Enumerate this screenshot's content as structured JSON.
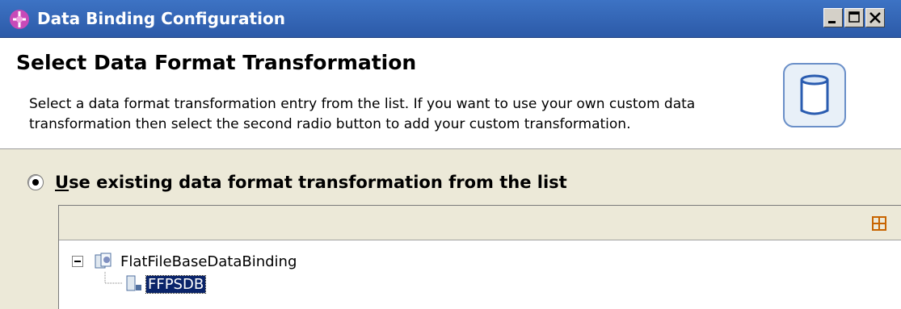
{
  "window": {
    "title": "Data Binding Configuration",
    "title_icon": "plug-in-icon",
    "controls": [
      "minimize",
      "maximize",
      "close"
    ]
  },
  "header": {
    "title": "Select Data Format Transformation",
    "description": "Select a data format transformation entry from the list.  If you want to use your own custom data transformation then select the second radio button to add your custom transformation.",
    "icon": "cylinder-icon"
  },
  "option": {
    "label_first_letter": "U",
    "label_rest": "se existing data format transformation from the list",
    "selected": true
  },
  "tree": {
    "toolbar_icon": "expand-all-icon",
    "items": [
      {
        "label": "FlatFileBaseDataBinding",
        "expanded": true,
        "icon": "databinding-folder-icon"
      },
      {
        "label": "FFPSDB",
        "selected": true,
        "icon": "databinding-node-icon"
      }
    ]
  },
  "colors": {
    "titlebar": "#3d73c4",
    "selection": "#0a246a",
    "dialog_background": "#ece9d8"
  }
}
